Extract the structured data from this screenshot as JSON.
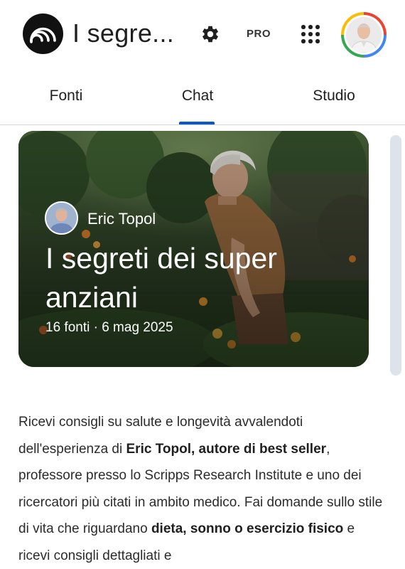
{
  "header": {
    "title": "I segre...",
    "pro_label": "PRO",
    "icons": {
      "logo": "notebook-logo-icon",
      "settings": "gear-icon",
      "apps": "apps-grid-icon",
      "account": "account-avatar"
    }
  },
  "tabs": [
    {
      "label": "Fonti",
      "selected": false
    },
    {
      "label": "Chat",
      "selected": true
    },
    {
      "label": "Studio",
      "selected": false
    }
  ],
  "hero": {
    "author": "Eric Topol",
    "title": "I segreti dei super anziani",
    "meta": "16 fonti · 6 mag 2025"
  },
  "description": {
    "p1": "Ricevi consigli su salute e longevità avvalendoti dell'esperienza di ",
    "b1": "Eric Topol, autore di best seller",
    "p2": ", professore presso lo Scripps Research Institute e uno dei ricercatori più citati in ambito medico. Fai domande sullo stile di vita che riguardano ",
    "b2": "dieta, sonno o esercizio fisico",
    "p3": " e ricevi consigli dettagliati e"
  },
  "colors": {
    "accent": "#0b57d0",
    "text": "#1f1f1f",
    "divider": "#d7d7d7"
  }
}
